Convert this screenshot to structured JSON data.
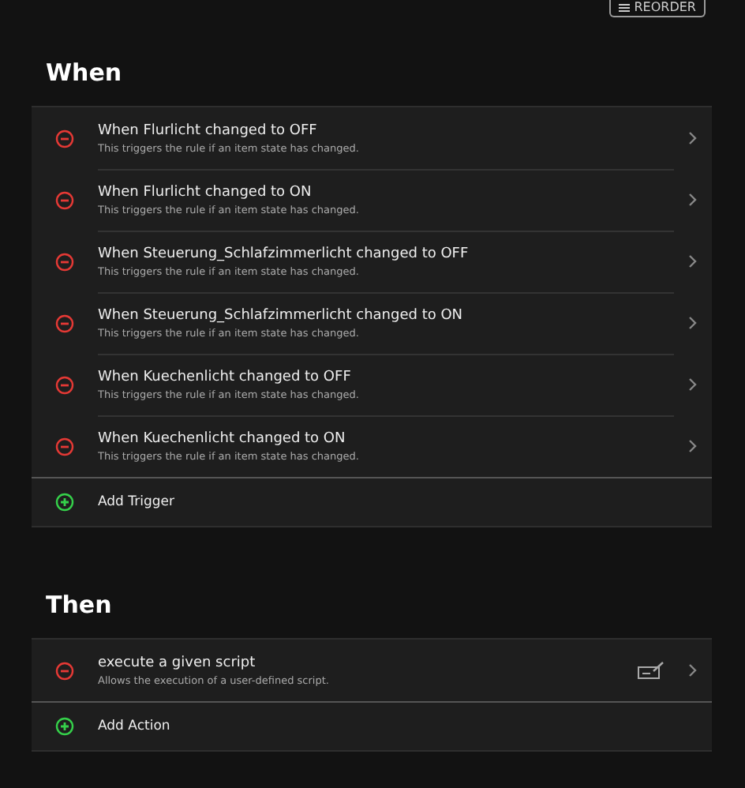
{
  "reorder_button": {
    "label": "REORDER"
  },
  "sections": [
    {
      "title": "When",
      "items": [
        {
          "title": "When Flurlicht changed to OFF",
          "description": "This triggers the rule if an item state has changed."
        },
        {
          "title": "When Flurlicht changed to ON",
          "description": "This triggers the rule if an item state has changed."
        },
        {
          "title": "When Steuerung_Schlafzimmerlicht changed to OFF",
          "description": "This triggers the rule if an item state has changed."
        },
        {
          "title": "When Steuerung_Schlafzimmerlicht changed to ON",
          "description": "This triggers the rule if an item state has changed."
        },
        {
          "title": "When Kuechenlicht changed to OFF",
          "description": "This triggers the rule if an item state has changed."
        },
        {
          "title": "When Kuechenlicht changed to ON",
          "description": "This triggers the rule if an item state has changed."
        }
      ],
      "add_label": "Add Trigger"
    },
    {
      "title": "Then",
      "items": [
        {
          "title": "execute a given script",
          "description": "Allows the execution of a user-defined script.",
          "kind": "script"
        }
      ],
      "add_label": "Add Action"
    }
  ]
}
